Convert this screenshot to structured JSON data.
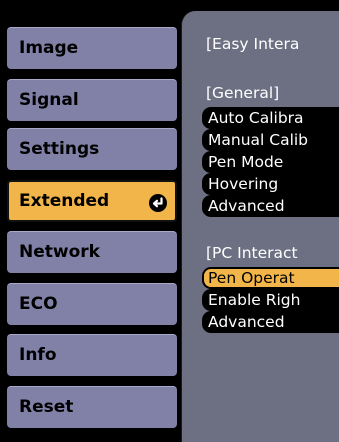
{
  "menu": {
    "items": [
      {
        "label": "Image"
      },
      {
        "label": "Signal"
      },
      {
        "label": "Settings"
      },
      {
        "label": "Extended",
        "active": true
      },
      {
        "label": "Network"
      },
      {
        "label": "ECO"
      },
      {
        "label": "Info"
      },
      {
        "label": "Reset"
      }
    ],
    "active_icon": "enter-icon"
  },
  "panel": {
    "title": "[Easy Intera",
    "general_heading": "[General]",
    "general_items": [
      {
        "label": "Auto Calibra"
      },
      {
        "label": "Manual Calib"
      },
      {
        "label": "Pen Mode"
      },
      {
        "label": "Hovering"
      },
      {
        "label": "Advanced"
      }
    ],
    "pc_heading": "[PC Interact",
    "pc_items": [
      {
        "label": "Pen Operat",
        "selected": true
      },
      {
        "label": "Enable Righ"
      },
      {
        "label": "Advanced"
      }
    ]
  },
  "colors": {
    "menu_item": "#8181a8",
    "active": "#f2b54a",
    "panel": "#6d7082",
    "background": "#000000"
  }
}
